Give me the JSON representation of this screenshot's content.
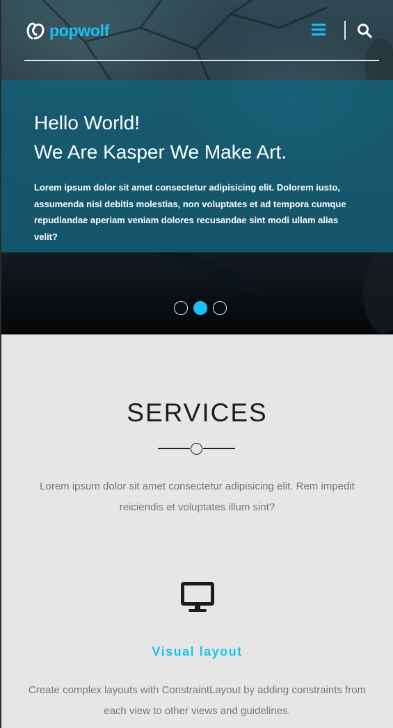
{
  "header": {
    "logo_text": "popwolf",
    "menu_icon": "hamburger-icon",
    "search_icon": "search-icon",
    "accent_color": "#19c1f3"
  },
  "hero": {
    "title_line1": "Hello World!",
    "title_line2": "We Are Kasper We Make Art.",
    "text": "Lorem ipsum dolor sit amet consectetur adipisicing elit. Dolorem iusto, assumenda nisi debitis molestias, non voluptates et ad tempora cumque repudiandae aperiam veniam dolores recusandae sint modi ullam alias velit?",
    "slides": {
      "count": 3,
      "active_index": 1
    }
  },
  "services": {
    "title": "SERVICES",
    "description": "Lorem ipsum dolor sit amet consectetur adipisicing elit. Rem impedit reiciendis et voluptates illum sint?",
    "feature": {
      "icon": "monitor-icon",
      "title": "Visual layout",
      "description": "Create complex layouts with ConstraintLayout by adding constraints from each view to other views and guidelines."
    }
  }
}
